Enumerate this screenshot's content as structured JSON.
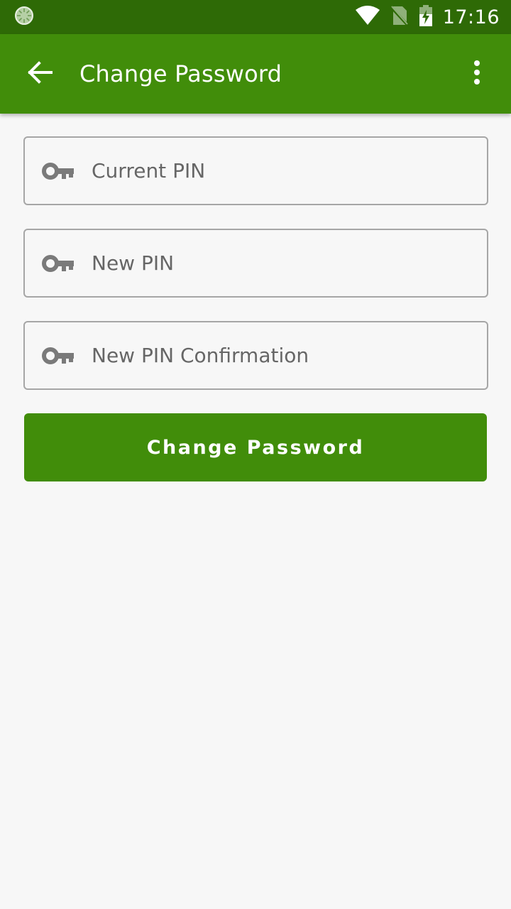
{
  "status_bar": {
    "time": "17:16",
    "icons": [
      "sync-indicator-icon",
      "wifi-icon",
      "no-sim-icon",
      "battery-charging-icon"
    ]
  },
  "app_bar": {
    "title": "Change Password",
    "back_icon": "arrow-back-icon",
    "menu_icon": "more-vert-icon"
  },
  "form": {
    "fields": [
      {
        "placeholder": "Current PIN",
        "value": "",
        "icon": "key-icon"
      },
      {
        "placeholder": "New PIN",
        "value": "",
        "icon": "key-icon"
      },
      {
        "placeholder": "New PIN Confirmation",
        "value": "",
        "icon": "key-icon"
      }
    ],
    "submit_label": "Change Password"
  },
  "colors": {
    "status_bar": "#2e6a06",
    "primary": "#418d0a",
    "background": "#f7f7f7",
    "field_border": "#a6a6a6",
    "icon_gray": "#7a7a7a"
  }
}
